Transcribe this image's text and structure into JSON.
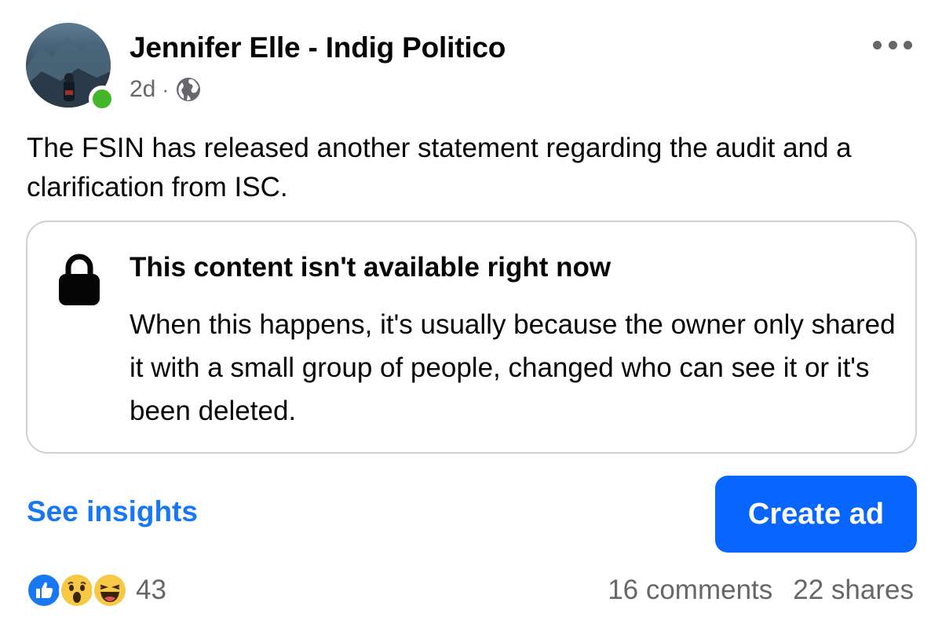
{
  "header": {
    "author": "Jennifer Elle - Indig Politico",
    "time": "2d",
    "separator": "·",
    "privacy_icon": "globe-icon",
    "more_icon": "more-options-icon"
  },
  "post": {
    "text": "The FSIN has released another statement regarding the audit and a clarification from ISC."
  },
  "unavailable_card": {
    "icon": "lock-icon",
    "title": "This content isn't available right now",
    "message": "When this happens, it's usually because the owner only shared it with a small group of people, changed who can see it or it's been deleted."
  },
  "actions": {
    "see_insights": "See insights",
    "create_ad": "Create ad"
  },
  "engagement": {
    "reaction_icons": [
      "like-icon",
      "wow-icon",
      "haha-icon"
    ],
    "reaction_count": "43",
    "comments": "16 comments",
    "shares": "22 shares"
  },
  "colors": {
    "link_blue": "#1877f2",
    "button_blue": "#0866ff",
    "online_green": "#42b72a",
    "secondary_text": "#65676b"
  }
}
